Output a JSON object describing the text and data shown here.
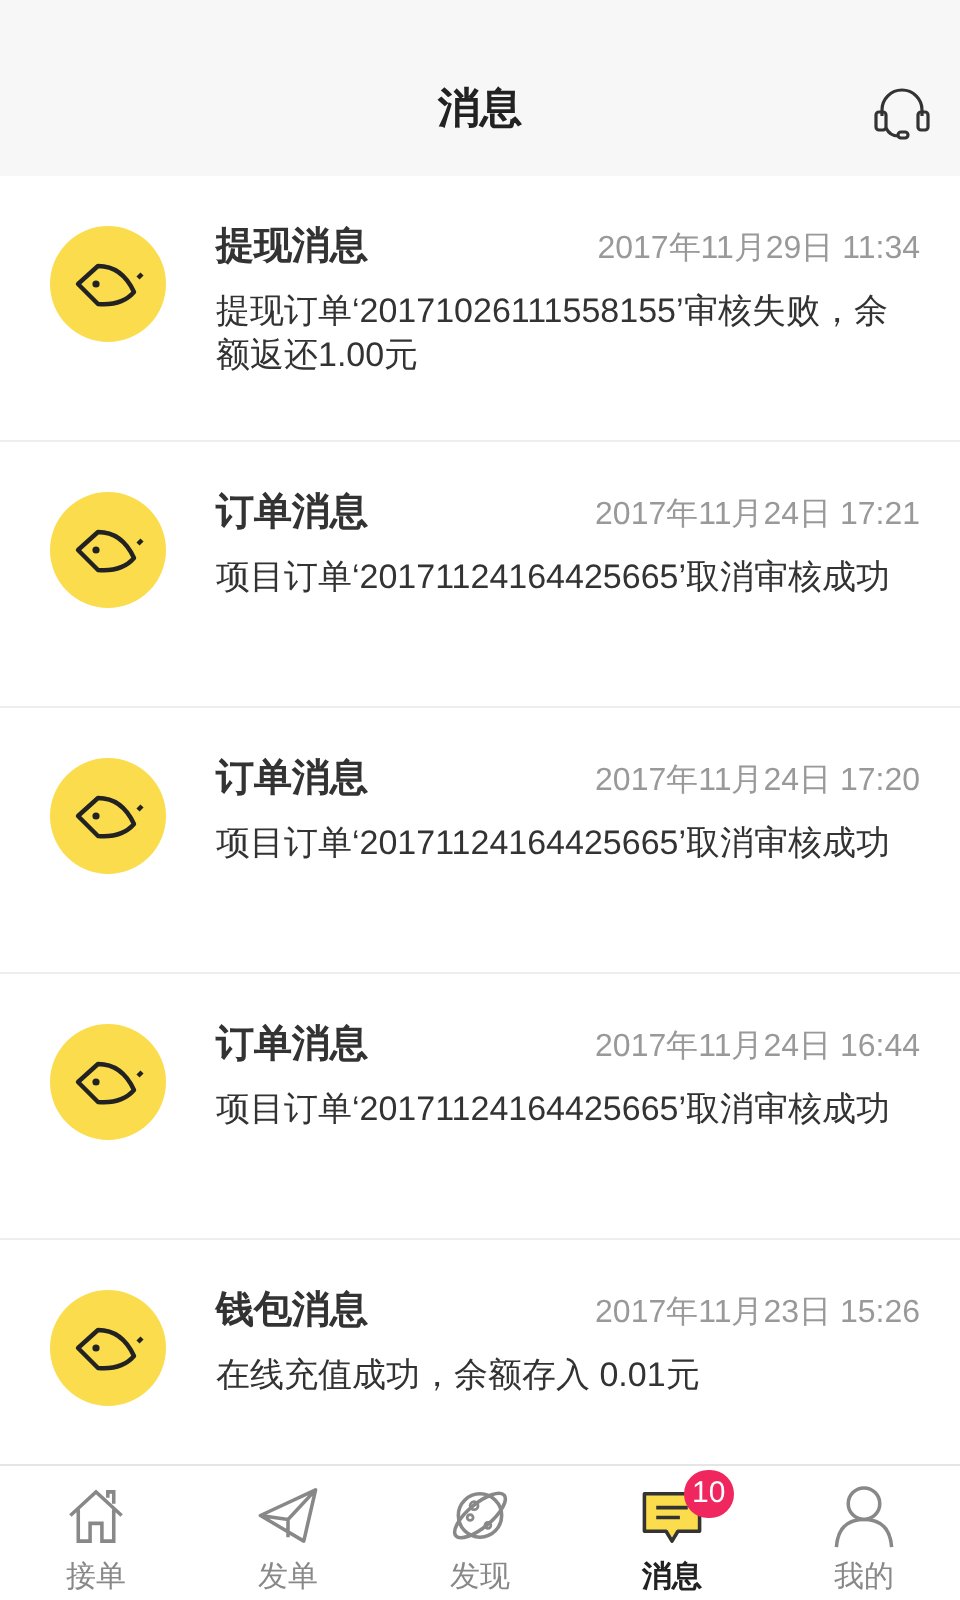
{
  "header": {
    "title": "消息"
  },
  "messages": [
    {
      "title": "提现消息",
      "time": "2017年11月29日 11:34",
      "body": "提现订单‘20171026111558155’审核失败，余额返还1.00元"
    },
    {
      "title": "订单消息",
      "time": "2017年11月24日 17:21",
      "body": "项目订单‘20171124164425665’取消审核成功"
    },
    {
      "title": "订单消息",
      "time": "2017年11月24日 17:20",
      "body": "项目订单‘20171124164425665’取消审核成功"
    },
    {
      "title": "订单消息",
      "time": "2017年11月24日 16:44",
      "body": "项目订单‘20171124164425665’取消审核成功"
    },
    {
      "title": "钱包消息",
      "time": "2017年11月23日 15:26",
      "body": "在线充值成功，余额存入 0.01元"
    }
  ],
  "tabs": [
    {
      "label": "接单",
      "selected": false
    },
    {
      "label": "发单",
      "selected": false
    },
    {
      "label": "发现",
      "selected": false
    },
    {
      "label": "消息",
      "selected": true,
      "badge": "10"
    },
    {
      "label": "我的",
      "selected": false
    }
  ]
}
